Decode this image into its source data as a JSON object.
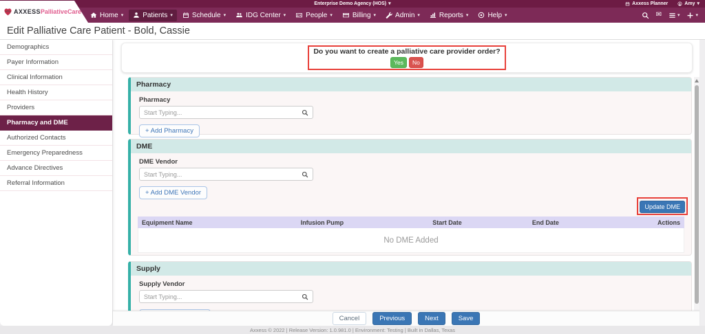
{
  "topbar": {
    "agency": "Enterprise Demo Agency (HOS)",
    "planner": "Axxess Planner",
    "user": "Amy"
  },
  "logo": {
    "axxess": "AXXESS",
    "product": "PalliativeCare"
  },
  "navbar": {
    "items": [
      "Home",
      "Patients",
      "Schedule",
      "IDG Center",
      "People",
      "Billing",
      "Admin",
      "Reports",
      "Help"
    ],
    "active_item": "Patients"
  },
  "page": {
    "title": "Edit Palliative Care Patient - Bold, Cassie"
  },
  "sidebar": {
    "items": [
      "Demographics",
      "Payer Information",
      "Clinical Information",
      "Health History",
      "Providers",
      "Pharmacy and DME",
      "Authorized Contacts",
      "Emergency Preparedness",
      "Advance Directives",
      "Referral Information"
    ],
    "active_item": "Pharmacy and DME"
  },
  "question": {
    "text": "Do you want to create a palliative care provider order?",
    "yes_label": "Yes",
    "no_label": "No"
  },
  "pharmacy": {
    "title": "Pharmacy",
    "field_label": "Pharmacy",
    "placeholder": "Start Typing...",
    "add_button": "+ Add Pharmacy"
  },
  "dme": {
    "title": "DME",
    "field_label": "DME Vendor",
    "placeholder": "Start Typing...",
    "add_button": "+ Add DME Vendor",
    "update_button": "Update DME",
    "table": {
      "columns": [
        "Equipment Name",
        "Infusion Pump",
        "Start Date",
        "End Date",
        "Actions"
      ],
      "empty_text": "No DME Added"
    }
  },
  "supply": {
    "title": "Supply",
    "field_label": "Supply Vendor",
    "placeholder": "Start Typing..."
  },
  "actions": {
    "cancel": "Cancel",
    "previous": "Previous",
    "next": "Next",
    "save": "Save"
  },
  "footer": {
    "text": "Axxess © 2022 | Release Version: 1.0.981.0 | Environment: Testing | Built in Dallas, Texas"
  },
  "icons": {
    "caret-down": "▾",
    "envelope": "✉",
    "search": "svg-magnifier",
    "home": "svg-house",
    "patients": "svg-person",
    "schedule": "svg-calendar",
    "idg-center": "svg-people-group",
    "people": "svg-id-card",
    "billing": "svg-credit-card",
    "admin": "svg-wrench",
    "reports": "svg-bar-chart",
    "help": "svg-circle-dot",
    "list-menu": "svg-list-lines",
    "plus": "svg-plus",
    "planner": "svg-calendar",
    "user-avatar": "svg-avatar-circle",
    "logo-heart": "svg-heart"
  },
  "colors": {
    "topbar_maroon": "#6d1b44",
    "navbar_purple": "#7d2a57",
    "nav_active": "#601d40",
    "sidebar_active": "#6d2148",
    "teal_accent": "#35b0a7",
    "teal_header_bg": "#d2e9e7",
    "card_bg": "#fbf6f6",
    "table_header_bg": "#dbd7f4",
    "primary_blue": "#3a76b5",
    "outline_blue": "#3f76b8",
    "yes_green": "#5cb85c",
    "no_red": "#d9534f",
    "annotation_red": "#e8403a",
    "logo_pink": "#e05c8e"
  }
}
